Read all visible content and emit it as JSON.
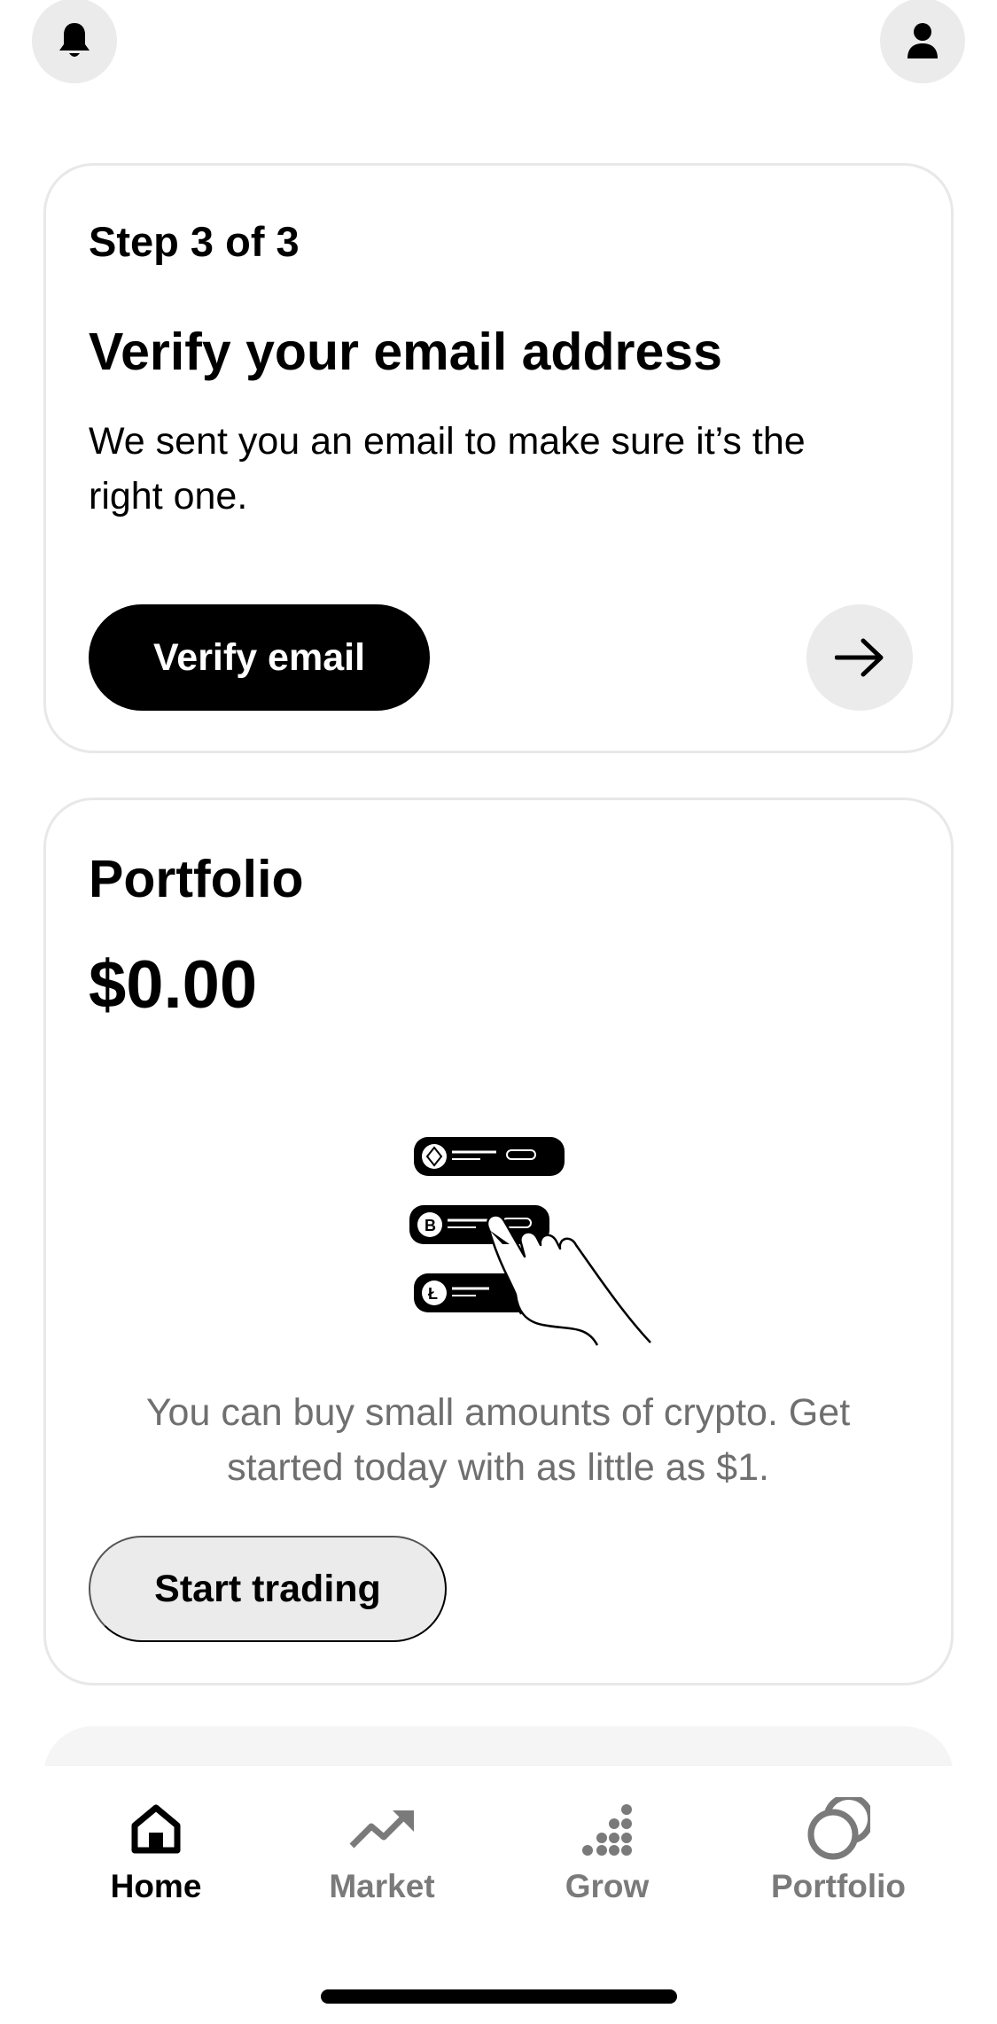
{
  "header": {
    "left_icon": "bell-icon",
    "right_icon": "profile-icon"
  },
  "verify_card": {
    "step": "Step 3 of 3",
    "title": "Verify your email address",
    "description": "We sent you an email to make sure it’s the right one.",
    "button_label": "Verify email",
    "next_icon": "arrow-right-icon"
  },
  "portfolio_card": {
    "title": "Portfolio",
    "value": "$0.00",
    "illustration_icon": "crypto-list-hand-illustration",
    "description": "You can buy small amounts of crypto. Get started today with as little as $1.",
    "button_label": "Start trading"
  },
  "tabbar": {
    "tabs": [
      {
        "label": "Home",
        "icon": "home-icon",
        "active": true
      },
      {
        "label": "Market",
        "icon": "trend-up-icon",
        "active": false
      },
      {
        "label": "Grow",
        "icon": "dots-icon",
        "active": false
      },
      {
        "label": "Portfolio",
        "icon": "coins-icon",
        "active": false
      }
    ]
  },
  "colors": {
    "accent": "#000000",
    "muted_text": "#6f6f6f",
    "button_gray": "#ebebeb",
    "card_border": "#e8e8e8"
  }
}
